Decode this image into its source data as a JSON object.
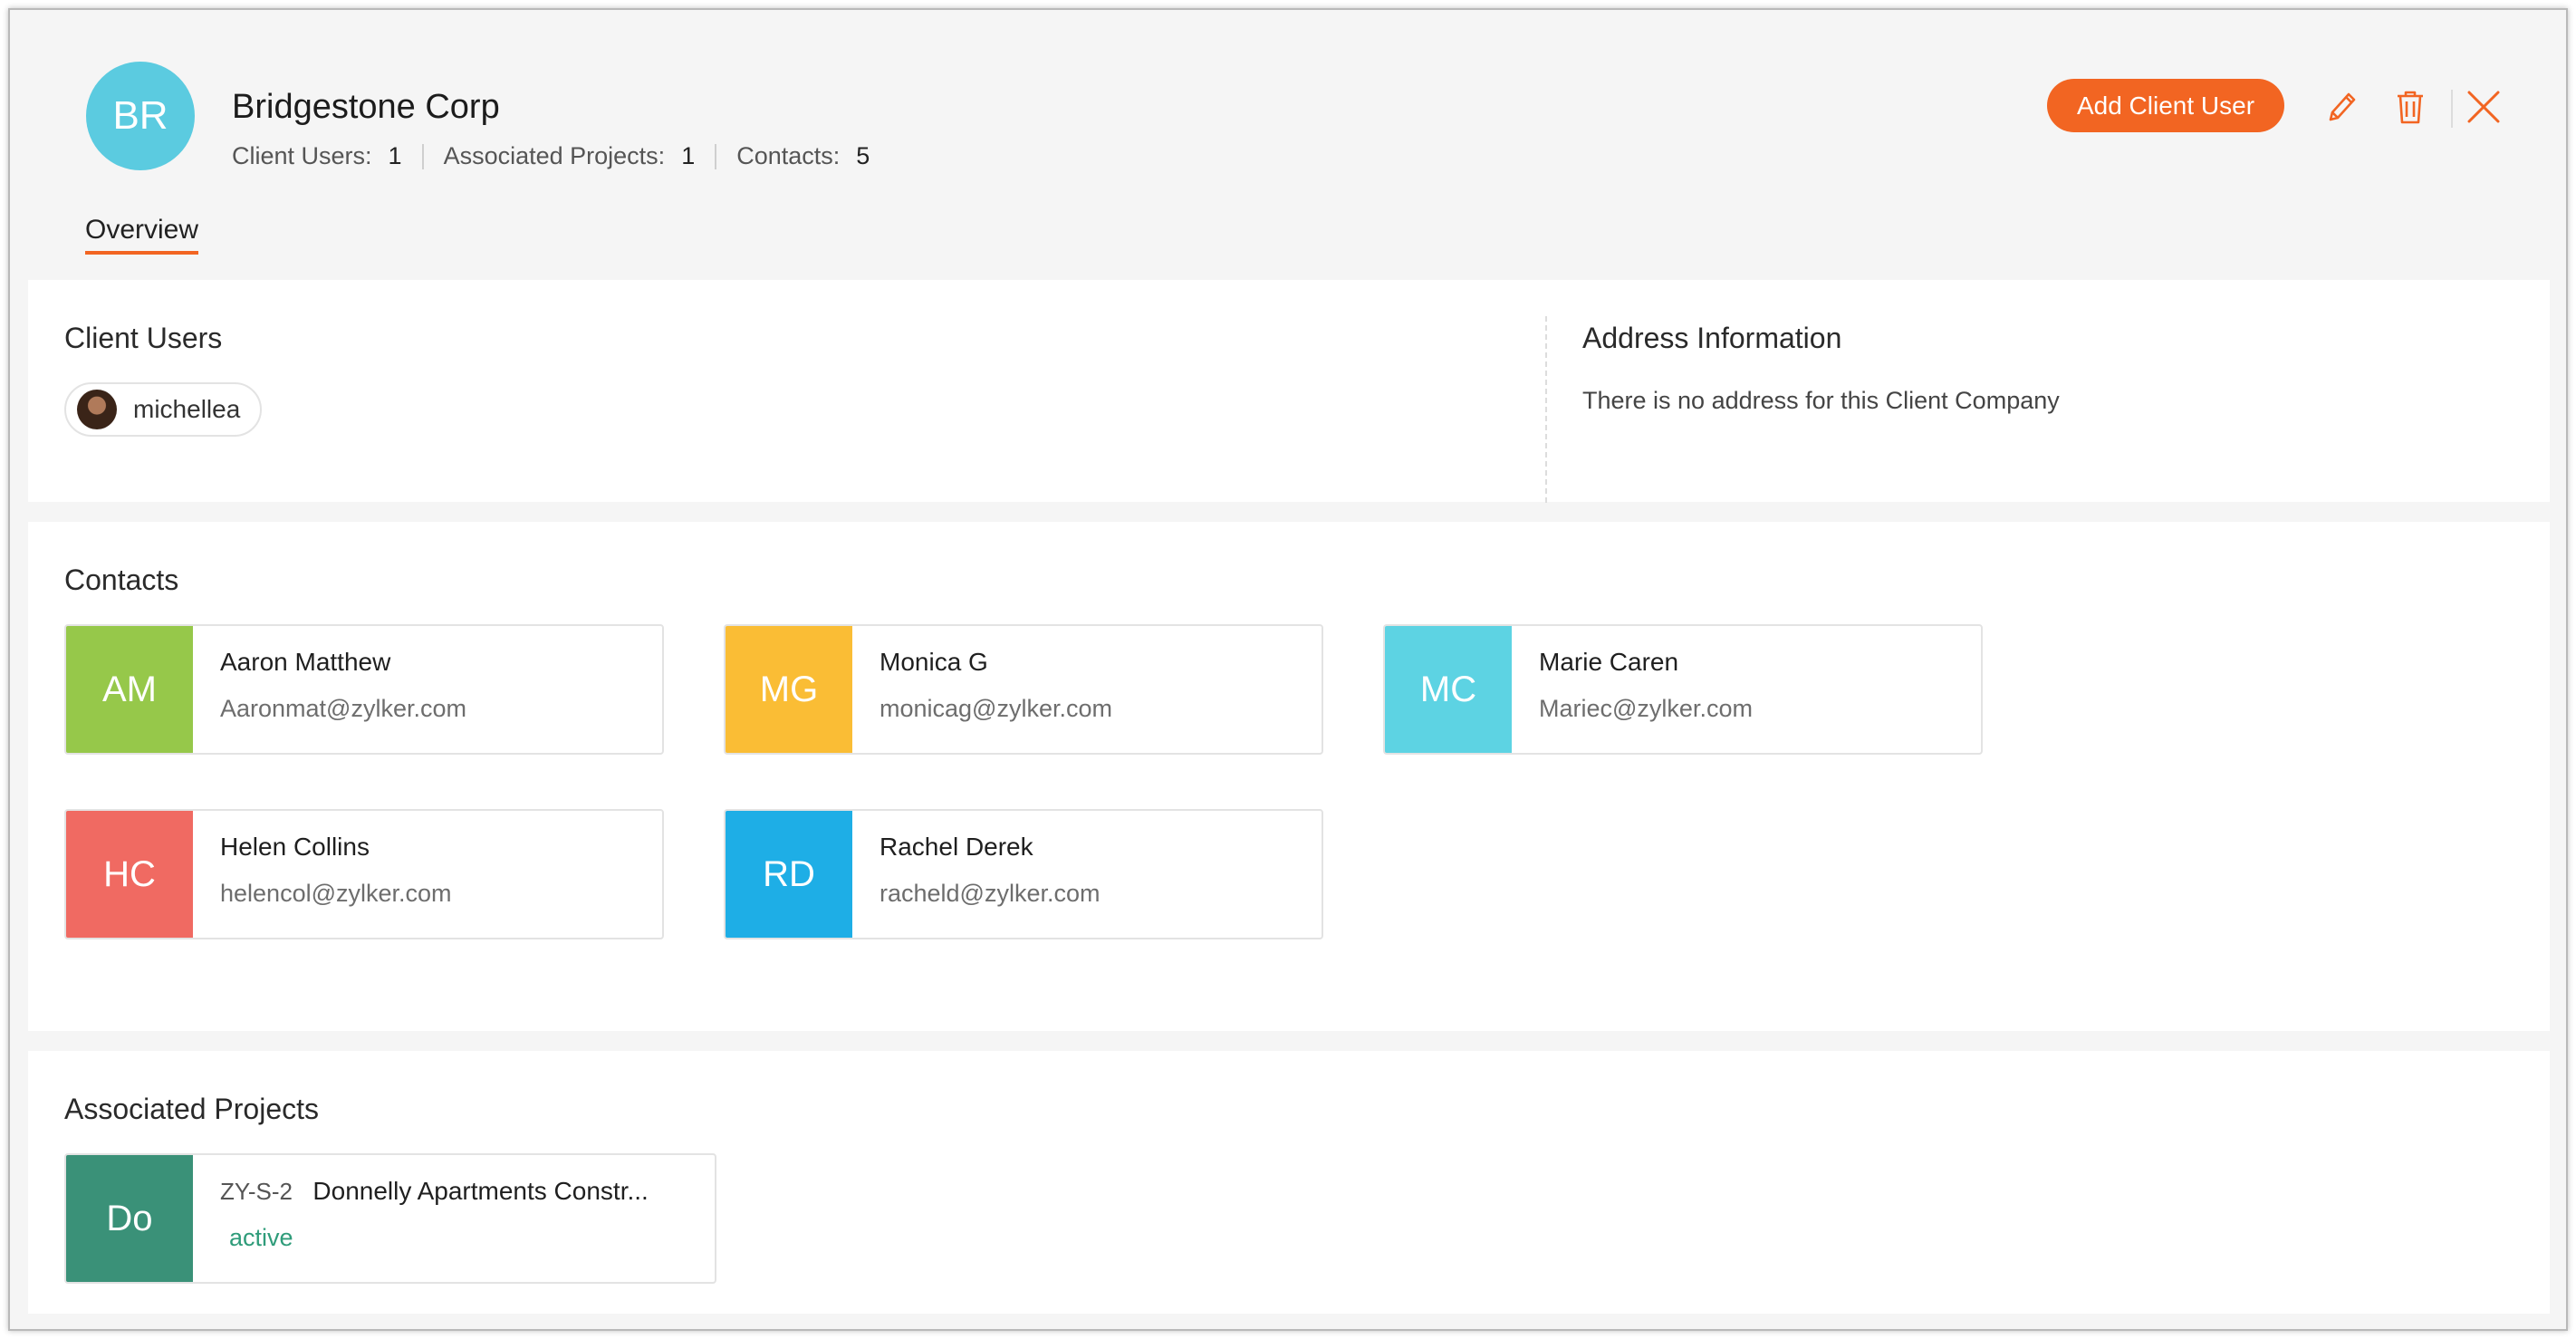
{
  "company": {
    "initials": "BR",
    "name": "Bridgestone Corp",
    "avatar_color": "#5bcbe0"
  },
  "stats": [
    {
      "label": "Client Users:",
      "value": "1"
    },
    {
      "label": "Associated Projects:",
      "value": "1"
    },
    {
      "label": "Contacts:",
      "value": "5"
    }
  ],
  "actions": {
    "add_client_user": "Add Client User",
    "accent_color": "#f26522",
    "icons": [
      "pencil-icon",
      "trash-icon",
      "close-icon"
    ]
  },
  "tabs": [
    {
      "label": "Overview",
      "active": true
    }
  ],
  "client_users": {
    "title": "Client Users",
    "users": [
      {
        "name": "michellea"
      }
    ]
  },
  "address": {
    "title": "Address Information",
    "message": "There is no address for this Client Company"
  },
  "contacts": {
    "title": "Contacts",
    "items": [
      {
        "initials": "AM",
        "name": "Aaron Matthew",
        "email": "Aaronmat@zylker.com",
        "color": "#96c84a"
      },
      {
        "initials": "MG",
        "name": "Monica G",
        "email": "monicag@zylker.com",
        "color": "#fabd35"
      },
      {
        "initials": "MC",
        "name": "Marie Caren",
        "email": "Mariec@zylker.com",
        "color": "#5dd3e3"
      },
      {
        "initials": "HC",
        "name": "Helen Collins",
        "email": "helencol@zylker.com",
        "color": "#f06a62"
      },
      {
        "initials": "RD",
        "name": "Rachel Derek",
        "email": "racheld@zylker.com",
        "color": "#1eaee6"
      }
    ]
  },
  "projects": {
    "title": "Associated Projects",
    "items": [
      {
        "initials": "Do",
        "id": "ZY-S-2",
        "name": "Donnelly Apartments Constr...",
        "status": "active",
        "color": "#3a9178",
        "status_color": "#2f9c7a"
      }
    ]
  }
}
